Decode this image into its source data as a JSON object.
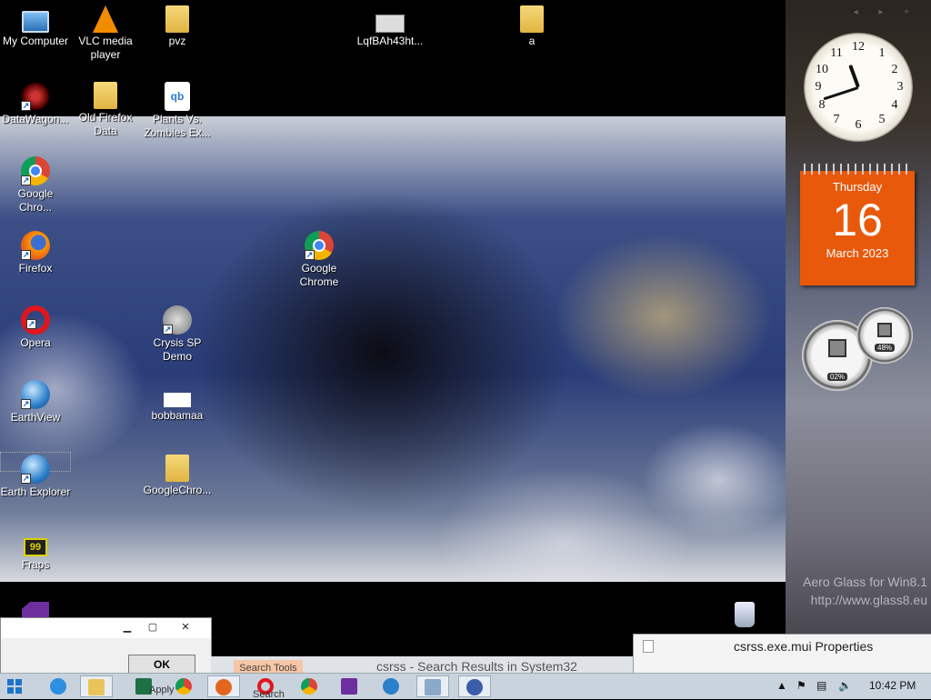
{
  "desktop": {
    "icons": [
      {
        "label": "My Computer",
        "icon": "computer-icon"
      },
      {
        "label": "VLC media player",
        "icon": "vlc-icon"
      },
      {
        "label": "pvz",
        "icon": "folder-icon"
      },
      {
        "label": "LqfBAh43ht...",
        "icon": "image-file-icon"
      },
      {
        "label": "a",
        "icon": "folder-icon"
      },
      {
        "label": "DataWagon...",
        "icon": "datawagon-icon"
      },
      {
        "label": "Old Firefox Data",
        "icon": "folder-icon"
      },
      {
        "label": "Plants Vs. Zombies Ex...",
        "icon": "qbittorrent-icon"
      },
      {
        "label": "Google Chro...",
        "icon": "chrome-icon"
      },
      {
        "label": "Firefox",
        "icon": "firefox-icon"
      },
      {
        "label": "Google Chrome",
        "icon": "chrome-icon"
      },
      {
        "label": "Opera",
        "icon": "opera-icon"
      },
      {
        "label": "Crysis SP Demo",
        "icon": "crysis-icon"
      },
      {
        "label": "EarthView",
        "icon": "earth-icon"
      },
      {
        "label": "bobbamaa",
        "icon": "image-file-icon"
      },
      {
        "label": "Earth Explorer",
        "icon": "earth-icon"
      },
      {
        "label": "GoogleChro...",
        "icon": "folder-icon"
      },
      {
        "label": "Fraps",
        "icon": "fraps-icon"
      },
      {
        "label": "",
        "icon": "visual-studio-icon"
      },
      {
        "label": "",
        "icon": "recycle-bin-icon"
      }
    ]
  },
  "gadgets": {
    "clock": {
      "numbers": [
        "12",
        "1",
        "2",
        "3",
        "4",
        "5",
        "6",
        "7",
        "8",
        "9",
        "10",
        "11"
      ],
      "time": "10:42"
    },
    "calendar": {
      "weekday": "Thursday",
      "day": "16",
      "month_year": "March 2023"
    },
    "meters": {
      "cpu": "02%",
      "memory": "48%"
    }
  },
  "watermark": {
    "line1": "Aero Glass for Win8.1",
    "line2": "http://www.glass8.eu"
  },
  "dialog": {
    "minimize": "▁",
    "maximize": "▢",
    "close": "✕",
    "ok_label": "OK"
  },
  "properties_window": {
    "title": "csrss.exe.mui Properties"
  },
  "explorer": {
    "tab_label": "Search Tools",
    "path_text": "csrss - Search Results in System32",
    "minimize": "▁",
    "maximize": "▢",
    "close": "✕"
  },
  "taskbar": {
    "apply_label": "Apply",
    "search_label": "Search",
    "clock": "10:42 PM",
    "items": [
      "internet-explorer-icon",
      "file-explorer-icon",
      "excel-icon",
      "chrome-icon",
      "firefox-icon",
      "opera-icon",
      "chrome-icon",
      "visual-studio-icon",
      "earth-icon",
      "image-viewer-icon",
      "earth-explorer-icon"
    ]
  },
  "colors": {
    "calendar": "#e8590c",
    "taskbar": "#c9d3de"
  }
}
